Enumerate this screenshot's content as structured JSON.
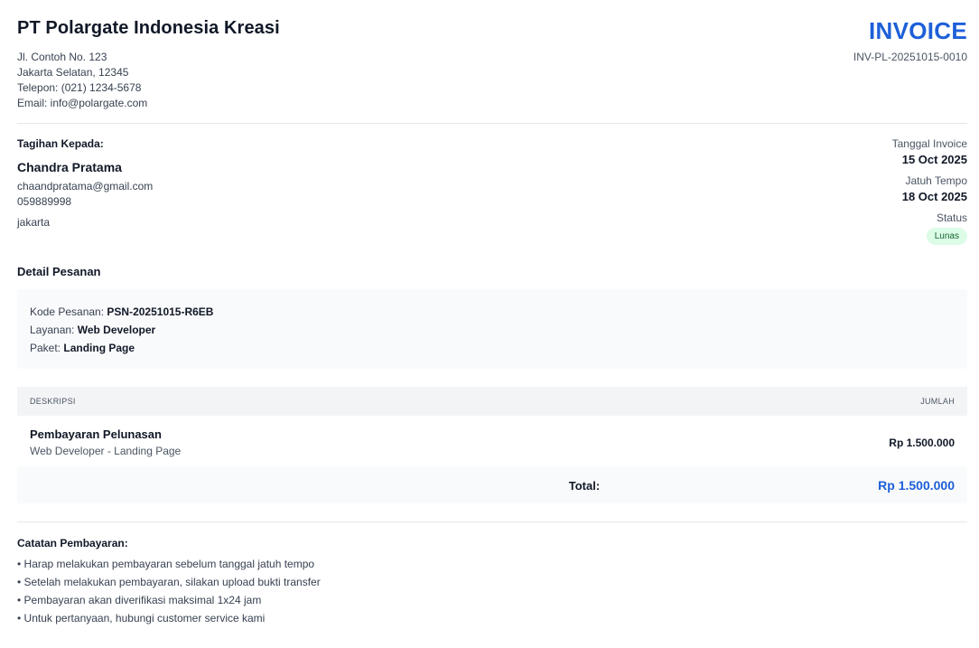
{
  "company": {
    "name": "PT Polargate Indonesia Kreasi",
    "address_line1": "Jl. Contoh No. 123",
    "address_line2": "Jakarta Selatan, 12345",
    "phone": "Telepon: (021) 1234-5678",
    "email": "Email: info@polargate.com"
  },
  "invoice": {
    "title": "INVOICE",
    "number": "INV-PL-20251015-0010"
  },
  "bill_to": {
    "heading": "Tagihan Kepada:",
    "name": "Chandra Pratama",
    "email": "chaandpratama@gmail.com",
    "phone": "059889998",
    "address": "jakarta"
  },
  "meta": {
    "invoice_date_label": "Tanggal Invoice",
    "invoice_date": "15 Oct 2025",
    "due_date_label": "Jatuh Tempo",
    "due_date": "18 Oct 2025",
    "status_label": "Status",
    "status": "Lunas",
    "status_color": "#dcfce7"
  },
  "order": {
    "section_title": "Detail Pesanan",
    "code_label": "Kode Pesanan: ",
    "code": "PSN-20251015-R6EB",
    "service_label": "Layanan: ",
    "service": "Web Developer",
    "package_label": "Paket: ",
    "package": "Landing Page"
  },
  "items_table": {
    "col_description": "DESKRIPSI",
    "col_amount": "JUMLAH",
    "rows": [
      {
        "title": "Pembayaran Pelunasan",
        "subtitle": "Web Developer - Landing Page",
        "amount": "Rp 1.500.000"
      }
    ],
    "total_label": "Total:",
    "total_value": "Rp 1.500.000"
  },
  "notes": {
    "title": "Catatan Pembayaran:",
    "items": [
      "• Harap melakukan pembayaran sebelum tanggal jatuh tempo",
      "• Setelah melakukan pembayaran, silakan upload bukti transfer",
      "• Pembayaran akan diverifikasi maksimal 1x24 jam",
      "• Untuk pertanyaan, hubungi customer service kami"
    ]
  },
  "colors": {
    "accent": "#1d5fd8",
    "status_text": "#166534"
  }
}
